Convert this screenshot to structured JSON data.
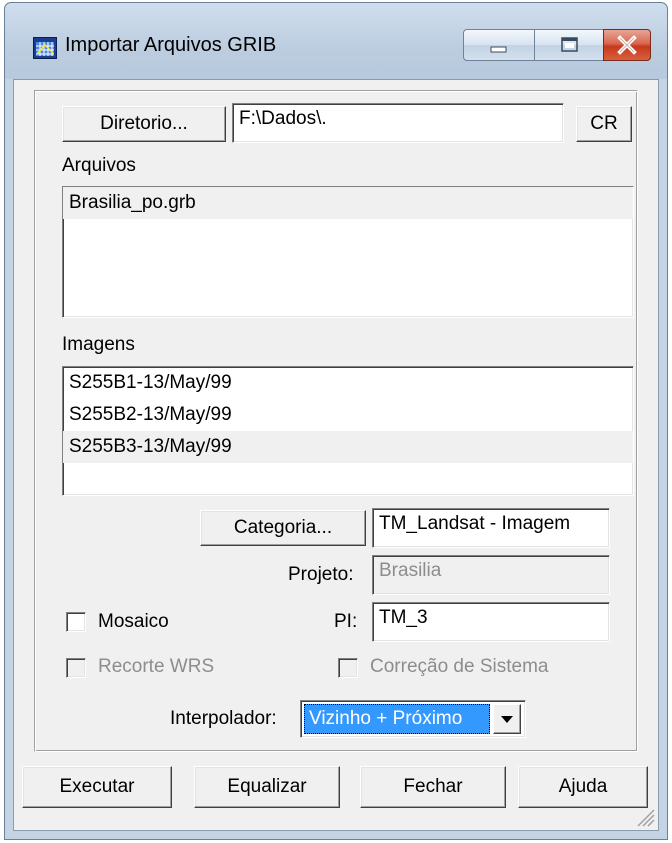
{
  "window": {
    "title": "Importar Arquivos GRIB",
    "icon": "grid-window-icon",
    "controls": [
      "minimize-icon",
      "maximize-icon",
      "close-icon"
    ]
  },
  "directory": {
    "button_label": "Diretorio...",
    "path_value": "F:\\Dados\\.",
    "cr_label": "CR"
  },
  "files": {
    "label": "Arquivos",
    "items": [
      "Brasilia_po.grb"
    ]
  },
  "images": {
    "label": "Imagens",
    "items": [
      "S255B1-13/May/99",
      "S255B2-13/May/99",
      "S255B3-13/May/99"
    ]
  },
  "category": {
    "button_label": "Categoria...",
    "value": "TM_Landsat - Imagem"
  },
  "project": {
    "label": "Projeto:",
    "value": "Brasilia"
  },
  "mosaic": {
    "label": "Mosaico",
    "checked": false
  },
  "pi": {
    "label": "PI:",
    "value": "TM_3"
  },
  "recorte": {
    "label": "Recorte WRS",
    "checked": false,
    "enabled": false
  },
  "correcao": {
    "label": "Correção de Sistema",
    "checked": false,
    "enabled": false
  },
  "interpolator": {
    "label": "Interpolador:",
    "selected": "Vizinho + Próximo"
  },
  "actions": {
    "execute": "Executar",
    "equalize": "Equalizar",
    "close": "Fechar",
    "help": "Ajuda"
  },
  "colors": {
    "titlebar": "#c4d4e4",
    "dialog_bg": "#f0f0f0",
    "close_button": "#c6391c",
    "selection": "#3399ff"
  }
}
